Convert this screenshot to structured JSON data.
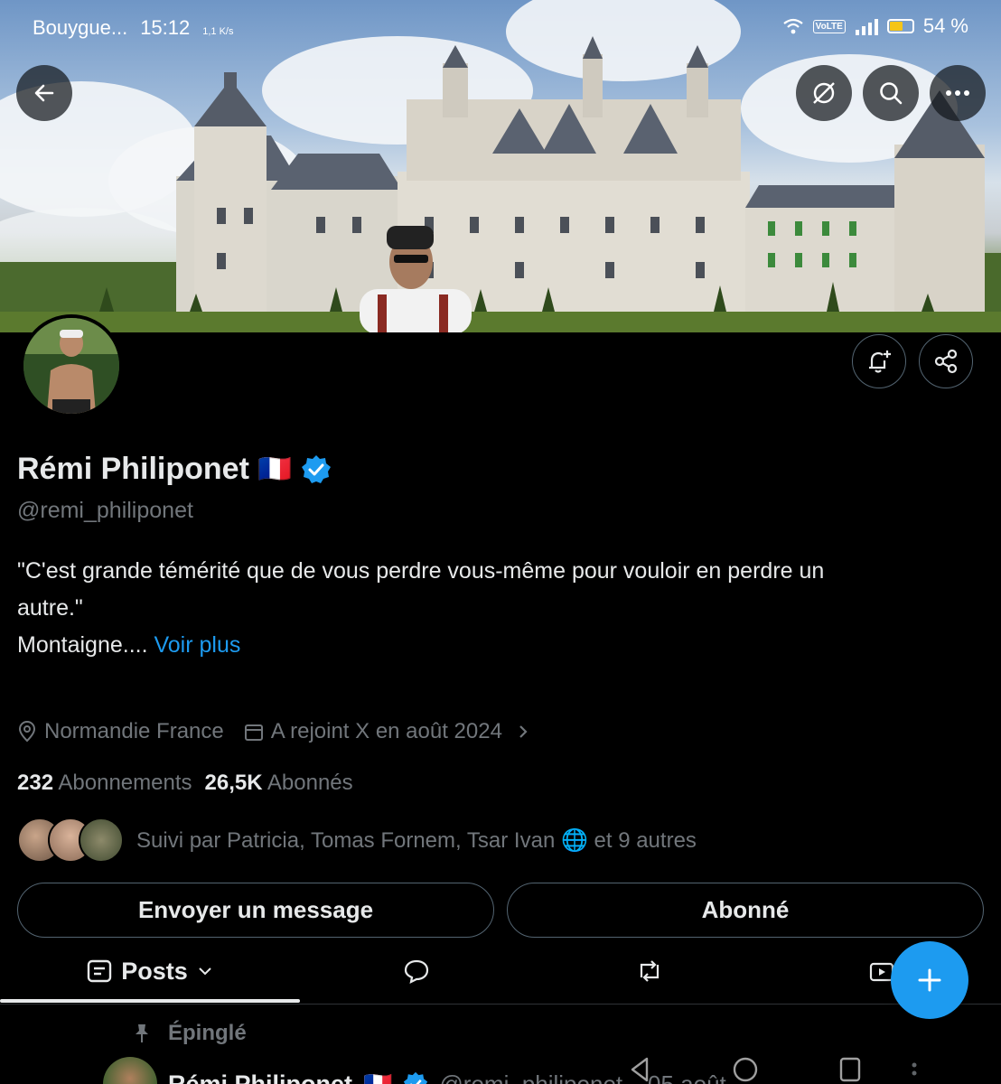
{
  "status_bar": {
    "carrier": "Bouygue...",
    "time": "15:12",
    "net_speed": "1,1 K/s",
    "volte": "VoLTE",
    "battery": "54 %"
  },
  "banner": {
    "back": "back",
    "icons": [
      "no-signal-icon",
      "search-icon",
      "more-icon"
    ]
  },
  "profile": {
    "name": "Rémi Philiponet",
    "flag": "🇫🇷",
    "handle": "@remi_philiponet",
    "bio_line1": "\"C'est grande témérité que de vous perdre vous-même pour vouloir en perdre un",
    "bio_line2": "autre.\"",
    "bio_line3": "Montaigne....",
    "see_more": "Voir plus",
    "location": "Normandie France",
    "joined": "A rejoint X en août 2024",
    "following_count": "232",
    "following_label": "Abonnements",
    "followers_count": "26,5K",
    "followers_label": "Abonnés",
    "followed_by": "Suivi par Patricia, Tomas Fornem, Tsar Ivan 🌐 et 9 autres"
  },
  "actions": {
    "message": "Envoyer un message",
    "follow": "Abonné"
  },
  "tabs": {
    "posts": "Posts"
  },
  "pinned": {
    "label": "Épinglé",
    "name": "Rémi Philiponet",
    "flag": "🇫🇷",
    "handle": "@remi_philiponet",
    "date": "· 05 août"
  },
  "colors": {
    "accent": "#1d9bf0",
    "muted": "#71767b",
    "text": "#e7e9ea",
    "background": "#000000"
  }
}
